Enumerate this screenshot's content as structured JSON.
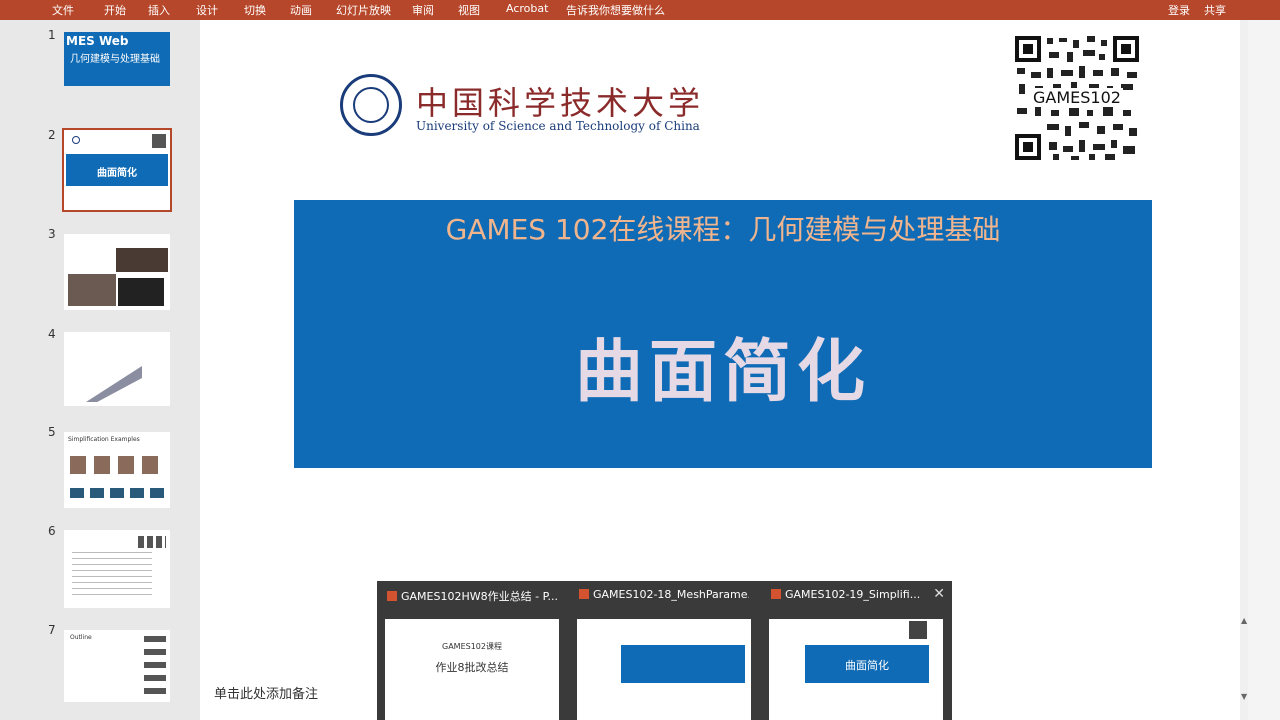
{
  "ribbon": {
    "tabs": [
      "文件",
      "开始",
      "插入",
      "设计",
      "切换",
      "动画",
      "幻灯片放映",
      "审阅",
      "视图",
      "Acrobat",
      "告诉我你想要做什么"
    ],
    "login": "登录",
    "share": "共享"
  },
  "thumbnails": [
    {
      "num": "1",
      "title": "几何建模与处理基础",
      "top_text": "MES Web"
    },
    {
      "num": "2",
      "title": "曲面简化"
    },
    {
      "num": "3"
    },
    {
      "num": "4"
    },
    {
      "num": "5",
      "title": "Simplification Examples"
    },
    {
      "num": "6"
    },
    {
      "num": "7",
      "title": "Outline"
    }
  ],
  "slide": {
    "university_cn": "中国科学技术大学",
    "university_en": "University of Science and Technology of China",
    "qr_label": "GAMES102",
    "course_title": "GAMES 102在线课程：几何建模与处理基础",
    "main_title": "曲面简化"
  },
  "notes_placeholder": "单击此处添加备注",
  "taskbar_previews": [
    {
      "title": "GAMES102HW8作业总结 - P...",
      "thumb_line1": "GAMES102课程",
      "thumb_line2": "作业8批改总结"
    },
    {
      "title": "GAMES102-18_MeshParame..."
    },
    {
      "title": "GAMES102-19_Simplifi...",
      "thumb_title": "曲面简化"
    }
  ],
  "colors": {
    "accent": "#b7472a",
    "banner": "#0f6bb5",
    "course_title": "#f1b58e"
  }
}
